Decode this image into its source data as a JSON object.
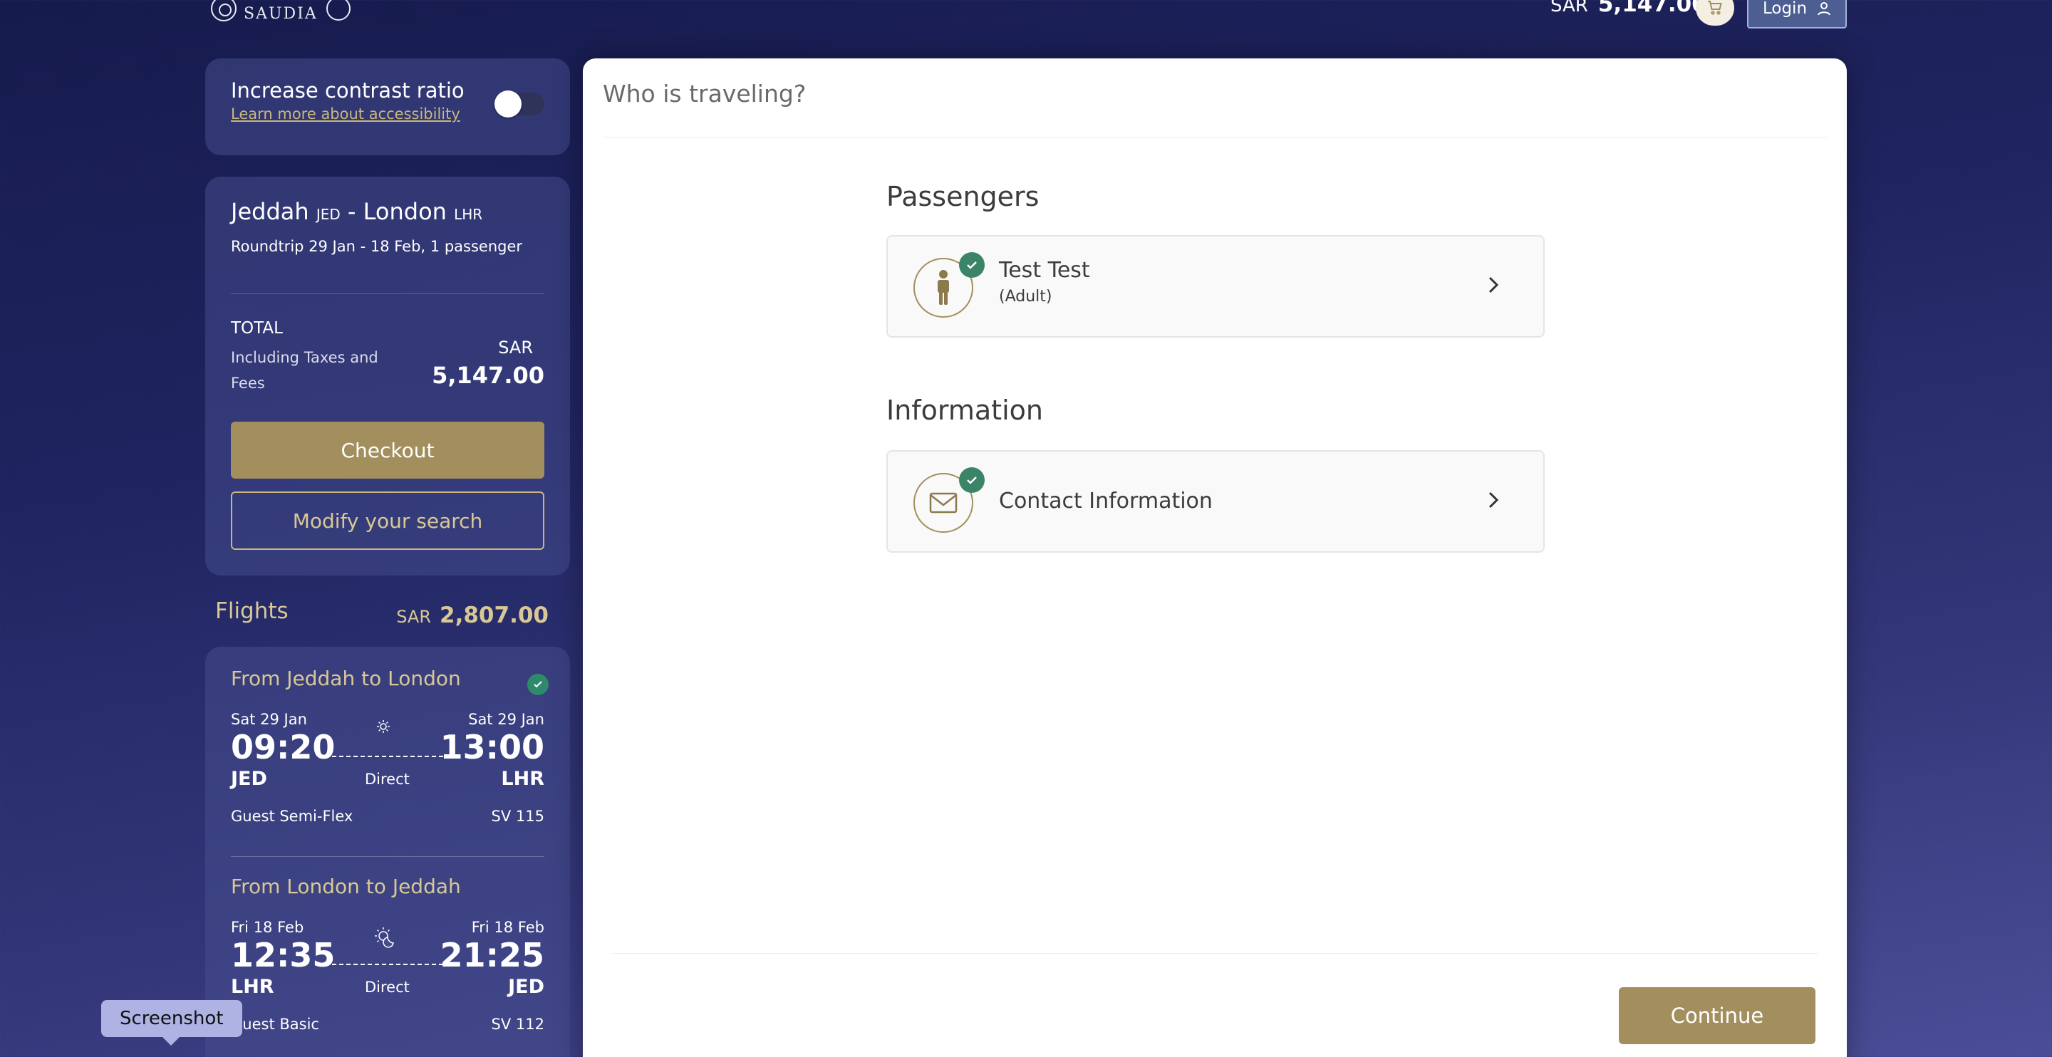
{
  "header": {
    "logo_text": "SAUDIA",
    "total_currency": "SAR",
    "total_amount": "5,147.00",
    "login_label": "Login"
  },
  "accessibility": {
    "title": "Increase contrast ratio",
    "link": "Learn more about accessibility",
    "enabled": false
  },
  "summary": {
    "origin_city": "Jeddah",
    "origin_code": "JED",
    "separator": "-",
    "destination_city": "London",
    "destination_code": "LHR",
    "trip_details": "Roundtrip 29 Jan - 18 Feb, 1 passenger",
    "total_label": "TOTAL",
    "total_desc": "Including Taxes and Fees",
    "total_currency": "SAR",
    "total_amount": "5,147.00",
    "checkout_label": "Checkout",
    "modify_label": "Modify your search"
  },
  "flights": {
    "heading": "Flights",
    "currency": "SAR",
    "amount": "2,807.00",
    "legs": [
      {
        "title": "From Jeddah to London",
        "dep_date": "Sat 29 Jan",
        "arr_date": "Sat 29 Jan",
        "dep_time": "09:20",
        "arr_time": "13:00",
        "dep_code": "JED",
        "arr_code": "LHR",
        "stops": "Direct",
        "fare": "Guest Semi-Flex",
        "flight_no": "SV 115",
        "icon": "sun-icon"
      },
      {
        "title": "From London to Jeddah",
        "dep_date": "Fri 18 Feb",
        "arr_date": "Fri 18 Feb",
        "dep_time": "12:35",
        "arr_time": "21:25",
        "dep_code": "LHR",
        "arr_code": "JED",
        "stops": "Direct",
        "fare": "Guest Basic",
        "flight_no": "SV 112",
        "icon": "sunset-icon"
      }
    ]
  },
  "main": {
    "title": "Who is traveling?",
    "passengers_heading": "Passengers",
    "passenger_name": "Test Test",
    "passenger_type": "(Adult)",
    "information_heading": "Information",
    "contact_label": "Contact Information",
    "continue_label": "Continue"
  },
  "tooltip": {
    "label": "Screenshot"
  },
  "colors": {
    "gold": "#a38f5e",
    "navy": "#1f2460",
    "success": "#3b8468"
  }
}
